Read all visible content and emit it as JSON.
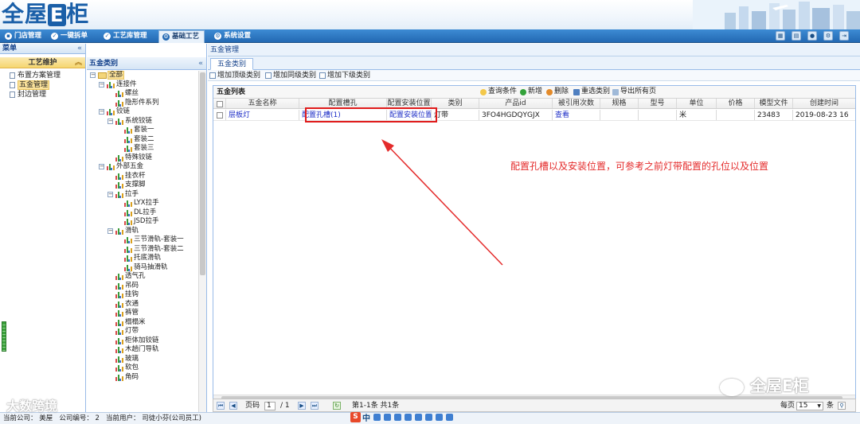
{
  "app": {
    "logo_prefix": "全屋",
    "logo_e": "E",
    "logo_suffix": "柜"
  },
  "nav": {
    "tabs": [
      {
        "label": "门店管理",
        "icon": "store-icon"
      },
      {
        "label": "一键拆单",
        "icon": "check-icon"
      },
      {
        "label": "工艺库管理",
        "icon": "check-icon"
      },
      {
        "label": "基础工艺",
        "icon": "gear-icon"
      },
      {
        "label": "系统设置",
        "icon": "gear-icon"
      }
    ],
    "active": "基础工艺"
  },
  "left": {
    "title": "菜单",
    "section": "工艺维护",
    "items": [
      "布置方案管理",
      "五金管理",
      "封边管理"
    ],
    "selected": "五金管理"
  },
  "mid": {
    "title": "五金类别",
    "tree": [
      {
        "label": "全部",
        "level": 0,
        "type": "folder",
        "expanded": true
      },
      {
        "label": "连接件",
        "level": 1,
        "type": "bars",
        "expanded": true
      },
      {
        "label": "螺丝",
        "level": 2,
        "type": "bars"
      },
      {
        "label": "隐形件系列",
        "level": 2,
        "type": "bars"
      },
      {
        "label": "铰链",
        "level": 1,
        "type": "bars",
        "expanded": true
      },
      {
        "label": "系统铰链",
        "level": 2,
        "type": "bars",
        "expanded": true
      },
      {
        "label": "套装一",
        "level": 3,
        "type": "bars"
      },
      {
        "label": "套装二",
        "level": 3,
        "type": "bars"
      },
      {
        "label": "套装三",
        "level": 3,
        "type": "bars"
      },
      {
        "label": "特殊铰链",
        "level": 2,
        "type": "bars"
      },
      {
        "label": "外部五金",
        "level": 1,
        "type": "bars",
        "expanded": true
      },
      {
        "label": "挂衣杆",
        "level": 2,
        "type": "bars"
      },
      {
        "label": "支撑脚",
        "level": 2,
        "type": "bars"
      },
      {
        "label": "拉手",
        "level": 2,
        "type": "bars",
        "expanded": true
      },
      {
        "label": "LYX拉手",
        "level": 3,
        "type": "bars"
      },
      {
        "label": "DL拉手",
        "level": 3,
        "type": "bars"
      },
      {
        "label": "JSD拉手",
        "level": 3,
        "type": "bars"
      },
      {
        "label": "滑轨",
        "level": 2,
        "type": "bars",
        "expanded": true
      },
      {
        "label": "三节滑轨-套装一",
        "level": 3,
        "type": "bars"
      },
      {
        "label": "三节滑轨-套装二",
        "level": 3,
        "type": "bars"
      },
      {
        "label": "托底滑轨",
        "level": 3,
        "type": "bars"
      },
      {
        "label": "骑马抽滑轨",
        "level": 3,
        "type": "bars"
      },
      {
        "label": "透气孔",
        "level": 2,
        "type": "bars"
      },
      {
        "label": "吊码",
        "level": 2,
        "type": "bars"
      },
      {
        "label": "挂钩",
        "level": 2,
        "type": "bars"
      },
      {
        "label": "衣通",
        "level": 2,
        "type": "bars"
      },
      {
        "label": "裤管",
        "level": 2,
        "type": "bars"
      },
      {
        "label": "榻榻米",
        "level": 2,
        "type": "bars"
      },
      {
        "label": "灯带",
        "level": 2,
        "type": "bars"
      },
      {
        "label": "柜体加铰链",
        "level": 2,
        "type": "bars"
      },
      {
        "label": "木趟门导轨",
        "level": 2,
        "type": "bars"
      },
      {
        "label": "玻璃",
        "level": 2,
        "type": "bars"
      },
      {
        "label": "软包",
        "level": 2,
        "type": "bars"
      },
      {
        "label": "角码",
        "level": 2,
        "type": "bars"
      }
    ]
  },
  "right": {
    "breadcrumb": "五金管理",
    "tab": "五金类别",
    "actions": [
      "增加顶级类别",
      "增加同级类别",
      "增加下级类别"
    ],
    "grid": {
      "title": "五金列表",
      "tools": [
        "查询条件",
        "新增",
        "删除",
        "重选类别",
        "导出所有页"
      ],
      "columns": [
        "五金名称",
        "配置槽孔",
        "配置安装位置",
        "类别",
        "产品id",
        "被引用次数",
        "规格",
        "型号",
        "单位",
        "价格",
        "模型文件",
        "创建时间"
      ],
      "rows": [
        [
          "层板灯",
          "配置孔槽(1)",
          "配置安装位置",
          "灯带",
          "3FO4HGDQYGJX",
          "查看",
          "",
          "",
          "米",
          "",
          "23483",
          "2019-08-23 16"
        ]
      ]
    },
    "annotation": "配置孔槽以及安装位置，可参考之前灯带配置的孔位以及位置",
    "pager": {
      "page_label": "页码",
      "page": "1",
      "of": "/ 1",
      "summary": "第1-1条  共1条",
      "per_page_label": "每页",
      "per_page": "15",
      "unit": "条"
    }
  },
  "status": {
    "company": "当前公司：  美屋",
    "company_no": "公司编号：  2",
    "user": "当前用户：  司徒小芬(公司员工)"
  },
  "watermarks": {
    "left": "大数跨境",
    "right": "全屋E柜"
  },
  "colors": {
    "brand": "#1a5fa8",
    "nav": "#2369b3",
    "highlight": "#fbe29a",
    "annotation": "#e42b2b"
  }
}
